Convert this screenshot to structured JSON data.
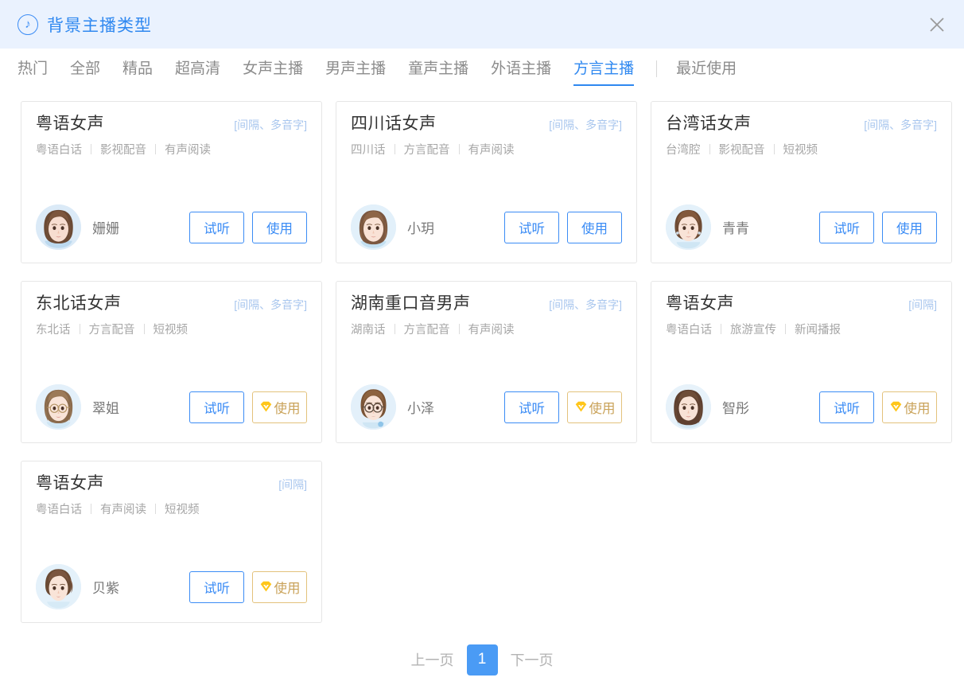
{
  "header": {
    "title": "背景主播类型",
    "icon": "music-note-icon",
    "close_icon": "close-icon",
    "accent_color": "#2f88f0",
    "background": "#eaf2fe"
  },
  "tabs": {
    "items": [
      {
        "label": "热门",
        "active": false
      },
      {
        "label": "全部",
        "active": false
      },
      {
        "label": "精品",
        "active": false
      },
      {
        "label": "超高清",
        "active": false
      },
      {
        "label": "女声主播",
        "active": false
      },
      {
        "label": "男声主播",
        "active": false
      },
      {
        "label": "童声主播",
        "active": false
      },
      {
        "label": "外语主播",
        "active": false
      },
      {
        "label": "方言主播",
        "active": true
      }
    ],
    "trailing": {
      "label": "最近使用",
      "active": false
    }
  },
  "buttons": {
    "preview": "试听",
    "use": "使用",
    "vip_icon": "vip-diamond-icon"
  },
  "cards": [
    {
      "title": "粤语女声",
      "badge": "[间隔、多音字]",
      "tags": [
        "粤语白话",
        "影视配音",
        "有声阅读"
      ],
      "voice_name": "姗姗",
      "avatar": "female-long-brown-hair",
      "vip": false
    },
    {
      "title": "四川话女声",
      "badge": "[间隔、多音字]",
      "tags": [
        "四川话",
        "方言配音",
        "有声阅读"
      ],
      "voice_name": "小玥",
      "avatar": "female-wavy-brown-hair",
      "vip": false
    },
    {
      "title": "台湾话女声",
      "badge": "[间隔、多音字]",
      "tags": [
        "台湾腔",
        "影视配音",
        "短视频"
      ],
      "voice_name": "青青",
      "avatar": "female-short-hair-earrings",
      "vip": false
    },
    {
      "title": "东北话女声",
      "badge": "[间隔、多音字]",
      "tags": [
        "东北话",
        "方言配音",
        "短视频"
      ],
      "voice_name": "翠姐",
      "avatar": "female-glasses",
      "vip": true
    },
    {
      "title": "湖南重口音男声",
      "badge": "[间隔、多音字]",
      "tags": [
        "湖南话",
        "方言配音",
        "有声阅读"
      ],
      "voice_name": "小泽",
      "avatar": "male-glasses",
      "vip": true
    },
    {
      "title": "粤语女声",
      "badge": "[间隔]",
      "tags": [
        "粤语白话",
        "旅游宣传",
        "新闻播报"
      ],
      "voice_name": "智彤",
      "avatar": "female-dark-long-hair",
      "vip": true
    },
    {
      "title": "粤语女声",
      "badge": "[间隔]",
      "tags": [
        "粤语白话",
        "有声阅读",
        "短视频"
      ],
      "voice_name": "贝紫",
      "avatar": "female-updo-hair",
      "vip": true
    }
  ],
  "pagination": {
    "prev": "上一页",
    "next": "下一页",
    "current_page": "1",
    "active_color": "#4a9bf5"
  }
}
